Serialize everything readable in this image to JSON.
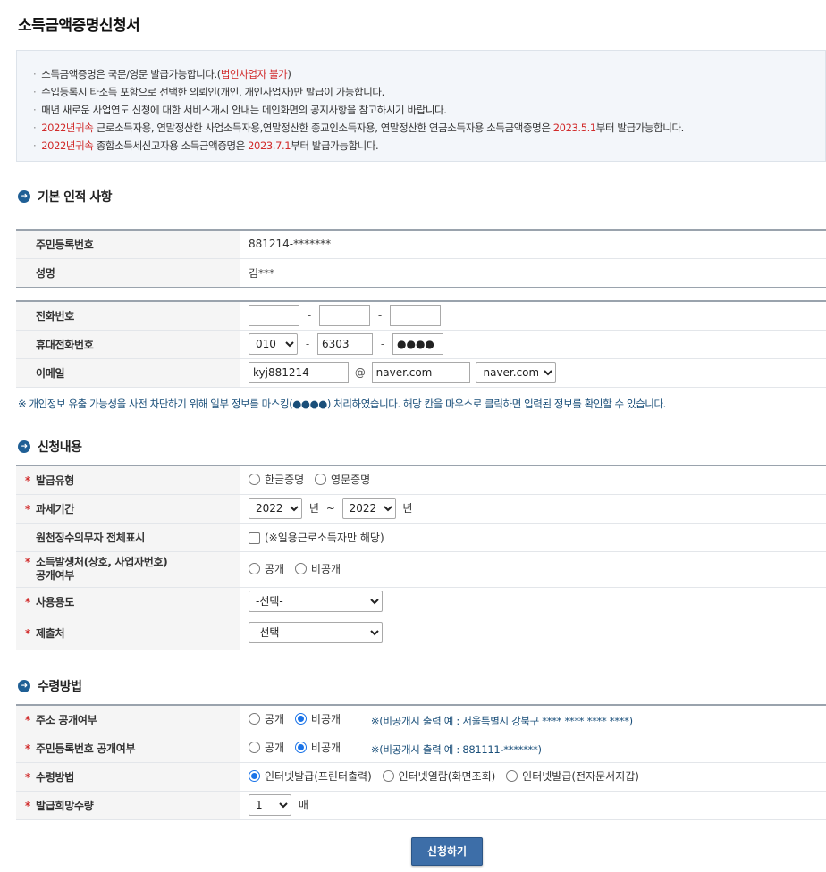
{
  "title": "소득금액증명신청서",
  "notice": {
    "line1": "소득금액증명은 국문/영문 발급가능합니다.(",
    "line1_red": "법인사업자 불가",
    "line1_end": ")",
    "line2": "수입등록시 타소득 포함으로 선택한 의뢰인(개인, 개인사업자)만 발급이 가능합니다.",
    "line3": "매년 새로운 사업연도 신청에 대한 서비스개시 안내는 메인화면의 공지사항을 참고하시기 바랍니다.",
    "line4_red": "2022년귀속",
    "line4": " 근로소득자용, 연말정산한 사업소득자용,연말정산한 종교인소득자용, 연말정산한 연금소득자용 소득금액증명은 ",
    "line4_date": "2023.5.1",
    "line4_end": "부터 발급가능합니다.",
    "line5_red": "2022년귀속",
    "line5": " 종합소득세신고자용 소득금액증명은 ",
    "line5_date": "2023.7.1",
    "line5_end": "부터 발급가능합니다."
  },
  "basic": {
    "heading": "기본 인적 사항",
    "rrn_label": "주민등록번호",
    "rrn_value": "881214-*******",
    "name_label": "성명",
    "name_value": "김***",
    "phone_label": "전화번호",
    "mobile_label": "휴대전화번호",
    "mobile_prefix": "010",
    "mobile_mid": "6303",
    "mobile_last": "●●●●",
    "email_label": "이메일",
    "email_id": "kyj881214",
    "email_at": "@",
    "email_domain": "naver.com",
    "email_select": "naver.com",
    "dash": "-"
  },
  "mask_note": "※ 개인정보 유출 가능성을 사전 차단하기 위해 일부 정보를 마스킹(●●●●) 처리하였습니다. 해당 칸을 마우스로 클릭하면 입력된 정보를 확인할 수 있습니다.",
  "apply": {
    "heading": "신청내용",
    "star": "*",
    "type_label": "발급유형",
    "type_ko": "한글증명",
    "type_en": "영문증명",
    "period_label": "과세기간",
    "year_from": "2022",
    "year_unit": "년",
    "tilde": "~",
    "year_to": "2022",
    "withholding_label": "원천징수의무자 전체표시",
    "withholding_note": "(※일용근로소득자만 해당)",
    "source_label_1": "소득발생처(상호, 사업자번호)",
    "source_label_2": "공개여부",
    "open": "공개",
    "closed": "비공개",
    "usage_label": "사용용도",
    "usage_value": "-선택-",
    "submit_to_label": "제출처",
    "submit_to_value": "-선택-"
  },
  "receive": {
    "heading": "수령방법",
    "addr_label": "주소 공개여부",
    "addr_note": "※(비공개시 출력 예 : 서울특별시 강북구 **** **** **** ****)",
    "rrn_open_label": "주민등록번호 공개여부",
    "rrn_note": "※(비공개시 출력 예 : 881111-*******)",
    "method_label": "수령방법",
    "method_1": "인터넷발급(프린터출력)",
    "method_2": "인터넷열람(화면조회)",
    "method_3": "인터넷발급(전자문서지갑)",
    "count_label": "발급희망수량",
    "count_value": "1",
    "count_unit": "매"
  },
  "submit_label": "신청하기"
}
